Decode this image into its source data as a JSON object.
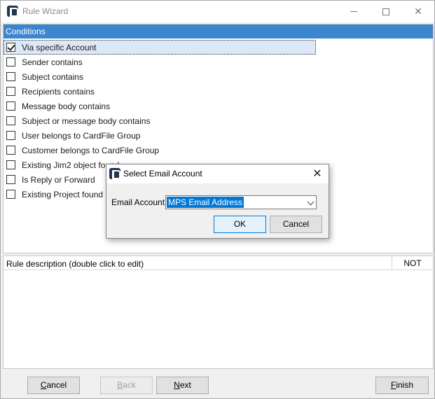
{
  "window": {
    "title": "Rule Wizard",
    "close_glyph": "✕"
  },
  "conditions": {
    "header": "Conditions",
    "items": [
      {
        "label": "Via specific Account",
        "checked": true
      },
      {
        "label": "Sender contains",
        "checked": false
      },
      {
        "label": "Subject contains",
        "checked": false
      },
      {
        "label": "Recipients contains",
        "checked": false
      },
      {
        "label": "Message body contains",
        "checked": false
      },
      {
        "label": "Subject or message body contains",
        "checked": false
      },
      {
        "label": "User belongs to CardFile Group",
        "checked": false
      },
      {
        "label": "Customer belongs to CardFile Group",
        "checked": false
      },
      {
        "label": "Existing Jim2 object found",
        "checked": false
      },
      {
        "label": "Is Reply or Forward",
        "checked": false
      },
      {
        "label": "Existing Project found",
        "checked": false
      }
    ]
  },
  "description": {
    "header": "Rule description (double click to edit)",
    "not_column": "NOT"
  },
  "footer": {
    "cancel": "Cancel",
    "back": "Back",
    "next": "Next",
    "finish": "Finish"
  },
  "dialog": {
    "title": "Select Email Account",
    "close_glyph": "✕",
    "field_label": "Email Account",
    "field_value": "MPS Email Address",
    "ok": "OK",
    "cancel": "Cancel"
  },
  "colors": {
    "header_blue": "#3c86cf",
    "selection_blue": "#0078d7",
    "app_icon": "#1f3550"
  }
}
